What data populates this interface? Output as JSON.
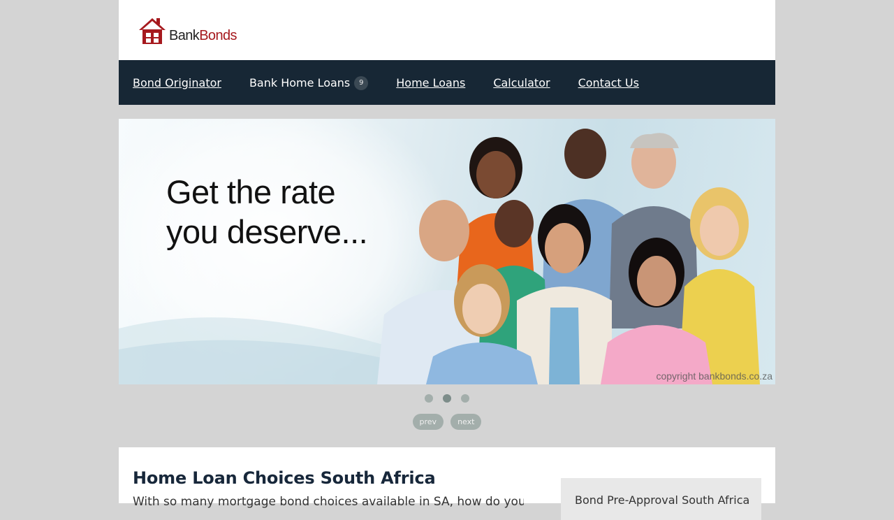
{
  "brand": {
    "logo_part1": "Bank",
    "logo_part2": "Bonds",
    "logo_icon": "house-icon",
    "accent": "#a6191e"
  },
  "nav": {
    "items": [
      {
        "label": "Bond Originator"
      },
      {
        "label": "Bank Home Loans",
        "badge": "9"
      },
      {
        "label": "Home Loans"
      },
      {
        "label": "Calculator"
      },
      {
        "label": "Contact Us"
      }
    ],
    "background": "#172735"
  },
  "hero": {
    "headline_line1": "Get the rate",
    "headline_line2": "you deserve...",
    "copyright": "copyright bankbonds.co.za"
  },
  "slider": {
    "slides": 3,
    "active_slide": 2,
    "prev_label": "prev",
    "next_label": "next"
  },
  "main": {
    "title": "Home Loan Choices South Africa",
    "intro": "With so many mortgage bond choices available in SA, how do you"
  },
  "sidebar": {
    "title": "Bond Pre-Approval South Africa"
  }
}
